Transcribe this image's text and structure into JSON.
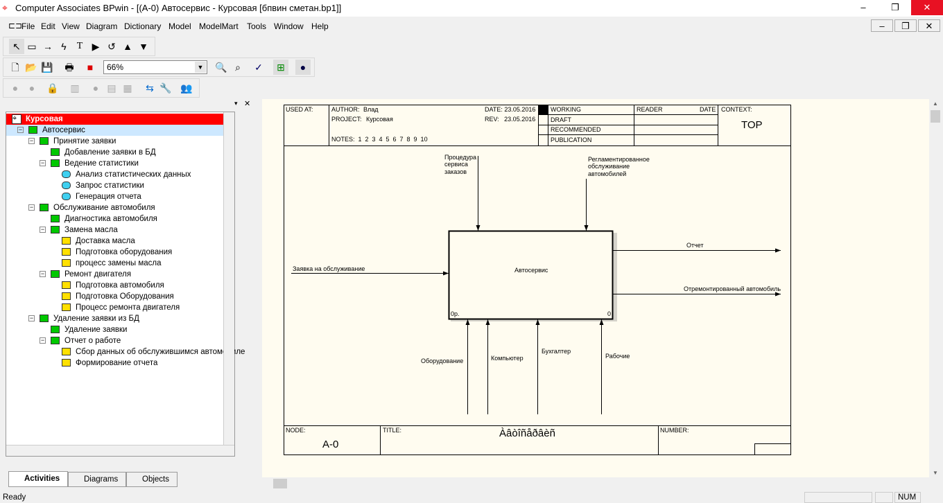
{
  "window": {
    "title": "Computer Associates BPwin - [(A-0) Автосервис - Курсовая  [бпвин сметан.bp1]]"
  },
  "menu": [
    "File",
    "Edit",
    "View",
    "Diagram",
    "Dictionary",
    "Model",
    "ModelMart",
    "Tools",
    "Window",
    "Help"
  ],
  "toolbar": {
    "zoom": "66%"
  },
  "tree": {
    "items": [
      {
        "label": "Курсовая",
        "level": 0,
        "icon": "model-icon"
      },
      {
        "label": "Автосервис",
        "level": 1,
        "icon": "green"
      },
      {
        "label": "Принятие заявки",
        "level": 2,
        "icon": "green"
      },
      {
        "label": "Добавление заявки в БД",
        "level": 3,
        "icon": "leaf"
      },
      {
        "label": "Ведение статистики",
        "level": 3,
        "icon": "green"
      },
      {
        "label": "Анализ статистических данных",
        "level": 4,
        "icon": "cyan"
      },
      {
        "label": "Запрос статистики",
        "level": 4,
        "icon": "cyan"
      },
      {
        "label": "Генерация отчета",
        "level": 4,
        "icon": "cyan"
      },
      {
        "label": "Обслуживание автомобиля",
        "level": 2,
        "icon": "green"
      },
      {
        "label": "Диагностика автомобиля",
        "level": 3,
        "icon": "leaf"
      },
      {
        "label": "Замена масла",
        "level": 3,
        "icon": "green"
      },
      {
        "label": "Доставка масла",
        "level": 4,
        "icon": "yellow"
      },
      {
        "label": "Подготовка оборудования",
        "level": 4,
        "icon": "yellow"
      },
      {
        "label": "процесс замены масла",
        "level": 4,
        "icon": "yellow"
      },
      {
        "label": "Ремонт двигателя",
        "level": 3,
        "icon": "green"
      },
      {
        "label": "Подготовка автомобиля",
        "level": 4,
        "icon": "yellow"
      },
      {
        "label": "Подготовка Оборудования",
        "level": 4,
        "icon": "yellow"
      },
      {
        "label": "Процесс ремонта двигателя",
        "level": 4,
        "icon": "yellow"
      },
      {
        "label": "Удаление заявки из БД",
        "level": 2,
        "icon": "green"
      },
      {
        "label": "Удаление заявки",
        "level": 3,
        "icon": "leaf"
      },
      {
        "label": "Отчет о работе",
        "level": 3,
        "icon": "green"
      },
      {
        "label": "Сбор данных об обслужившимся автомобиле",
        "level": 4,
        "icon": "yellow"
      },
      {
        "label": "Формирование отчета",
        "level": 4,
        "icon": "yellow"
      }
    ]
  },
  "tabs": [
    "Activities",
    "Diagrams",
    "Objects"
  ],
  "diagram": {
    "used_at": "USED AT:",
    "author_label": "AUTHOR:",
    "author": "Влад",
    "project_label": "PROJECT:",
    "project": "Курсовая",
    "date": "DATE: 23.05.2016",
    "rev": "REV:   23.05.2016",
    "notes": "NOTES:  1  2  3  4  5  6  7  8  9  10",
    "status": [
      "WORKING",
      "DRAFT",
      "RECOMMENDED",
      "PUBLICATION"
    ],
    "reader": "READER",
    "date_col": "DATE",
    "context": "CONTEXT:",
    "context_value": "TOP",
    "box": "Автосервис",
    "box_cost": "0р.",
    "box_num": "0",
    "controls": [
      "Процедура\nсервиса\nзаказов",
      "Регламентированное\nобслуживание\nавтомобилей"
    ],
    "inputs": [
      "Заявка на обслуживание"
    ],
    "outputs": [
      "Отчет",
      "Отремонтированный автомобиль"
    ],
    "mechanisms": [
      "Оборудование",
      "Компьютер",
      "Бухгалтер",
      "Рабочие"
    ],
    "node_label": "NODE:",
    "node": "A-0",
    "title_label": "TITLE:",
    "title": "Àâòîñåðâèñ",
    "number_label": "NUMBER:"
  },
  "status": {
    "text": "Ready",
    "num": "NUM"
  }
}
